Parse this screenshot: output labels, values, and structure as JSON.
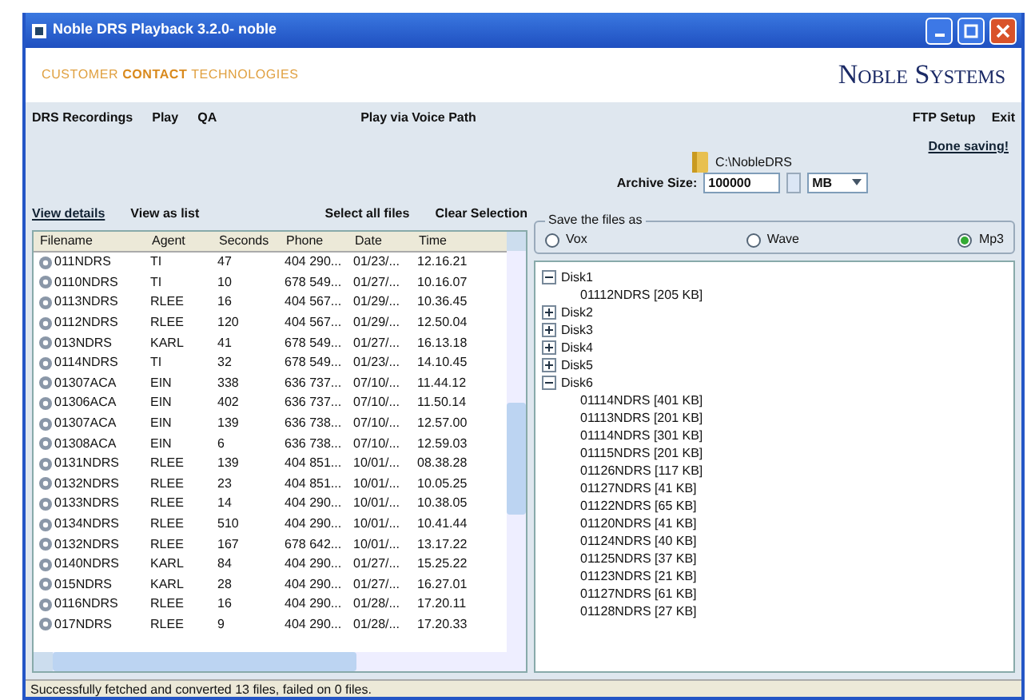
{
  "window": {
    "title": "Noble DRS Playback 3.2.0- noble"
  },
  "banner": {
    "tagline_1": "CUSTOMER",
    "tagline_2": "CONTACT",
    "tagline_3": "TECHNOLOGIES",
    "logo": "Noble Systems"
  },
  "menu": {
    "left": [
      "DRS Recordings",
      "Play",
      "QA",
      "Play via Voice Path"
    ],
    "right": [
      "FTP Setup",
      "Exit"
    ]
  },
  "archive": {
    "path": "C:\\NobleDRS",
    "label": "Archive Size:",
    "size": "100000",
    "unit": "MB",
    "done_link": "Done saving!"
  },
  "views": [
    "View details",
    "View as list"
  ],
  "actions": [
    "Select all files",
    "Clear Selection"
  ],
  "table": {
    "columns": [
      "Filename",
      "Agent",
      "Seconds",
      "Phone",
      "Date",
      "Time"
    ],
    "rows": [
      [
        "011NDRS",
        "TI",
        "47",
        "404 290...",
        "01/23/...",
        "12.16.21"
      ],
      [
        "0110NDRS",
        "TI",
        "10",
        "678 549...",
        "01/27/...",
        "10.16.07"
      ],
      [
        "0113NDRS",
        "RLEE",
        "16",
        "404 567...",
        "01/29/...",
        "10.36.45"
      ],
      [
        "0112NDRS",
        "RLEE",
        "120",
        "404 567...",
        "01/29/...",
        "12.50.04"
      ],
      [
        "013NDRS",
        "KARL",
        "41",
        "678 549...",
        "01/27/...",
        "16.13.18"
      ],
      [
        "0114NDRS",
        "TI",
        "32",
        "678 549...",
        "01/23/...",
        "14.10.45"
      ],
      [
        "01307ACA",
        "EIN",
        "338",
        "636 737...",
        "07/10/...",
        "11.44.12"
      ],
      [
        "01306ACA",
        "EIN",
        "402",
        "636 737...",
        "07/10/...",
        "11.50.14"
      ],
      [
        "01307ACA",
        "EIN",
        "139",
        "636 738...",
        "07/10/...",
        "12.57.00"
      ],
      [
        "01308ACA",
        "EIN",
        "6",
        "636 738...",
        "07/10/...",
        "12.59.03"
      ],
      [
        "0131NDRS",
        "RLEE",
        "139",
        "404 851...",
        "10/01/...",
        "08.38.28"
      ],
      [
        "0132NDRS",
        "RLEE",
        "23",
        "404 851...",
        "10/01/...",
        "10.05.25"
      ],
      [
        "0133NDRS",
        "RLEE",
        "14",
        "404 290...",
        "10/01/...",
        "10.38.05"
      ],
      [
        "0134NDRS",
        "RLEE",
        "510",
        "404 290...",
        "10/01/...",
        "10.41.44"
      ],
      [
        "0132NDRS",
        "RLEE",
        "167",
        "678 642...",
        "10/01/...",
        "13.17.22"
      ],
      [
        "0140NDRS",
        "KARL",
        "84",
        "404 290...",
        "01/27/...",
        "15.25.22"
      ],
      [
        "015NDRS",
        "KARL",
        "28",
        "404 290...",
        "01/27/...",
        "16.27.01"
      ],
      [
        "0116NDRS",
        "RLEE",
        "16",
        "404 290...",
        "01/28/...",
        "17.20.11"
      ],
      [
        "017NDRS",
        "RLEE",
        "9",
        "404 290...",
        "01/28/...",
        "17.20.33"
      ]
    ]
  },
  "save_as": {
    "legend": "Save the files as",
    "options": [
      {
        "label": "Vox",
        "selected": false
      },
      {
        "label": "Wave",
        "selected": false
      },
      {
        "label": "Mp3",
        "selected": true
      }
    ]
  },
  "tree": [
    {
      "label": "Disk1",
      "expanded": true,
      "children": [
        {
          "label": "01112NDRS [205 KB]"
        }
      ]
    },
    {
      "label": "Disk2",
      "expanded": false
    },
    {
      "label": "Disk3",
      "expanded": false
    },
    {
      "label": "Disk4",
      "expanded": false
    },
    {
      "label": "Disk5",
      "expanded": false
    },
    {
      "label": "Disk6",
      "expanded": true,
      "children": [
        {
          "label": "01114NDRS [401 KB]"
        },
        {
          "label": "01113NDRS [201 KB]"
        },
        {
          "label": "01114NDRS [301 KB]"
        },
        {
          "label": "01115NDRS [201 KB]"
        },
        {
          "label": "01126NDRS [117 KB]"
        },
        {
          "label": "01127NDRS [41 KB]"
        },
        {
          "label": "01122NDRS [65 KB]"
        },
        {
          "label": "01120NDRS [41 KB]"
        },
        {
          "label": "01124NDRS [40 KB]"
        },
        {
          "label": "01125NDRS [37 KB]"
        },
        {
          "label": "01123NDRS [21 KB]"
        },
        {
          "label": "01127NDRS [61 KB]"
        },
        {
          "label": "01128NDRS [27 KB]"
        }
      ]
    }
  ],
  "status_bar": "Successfully fetched and converted 13 files, failed on 0 files."
}
